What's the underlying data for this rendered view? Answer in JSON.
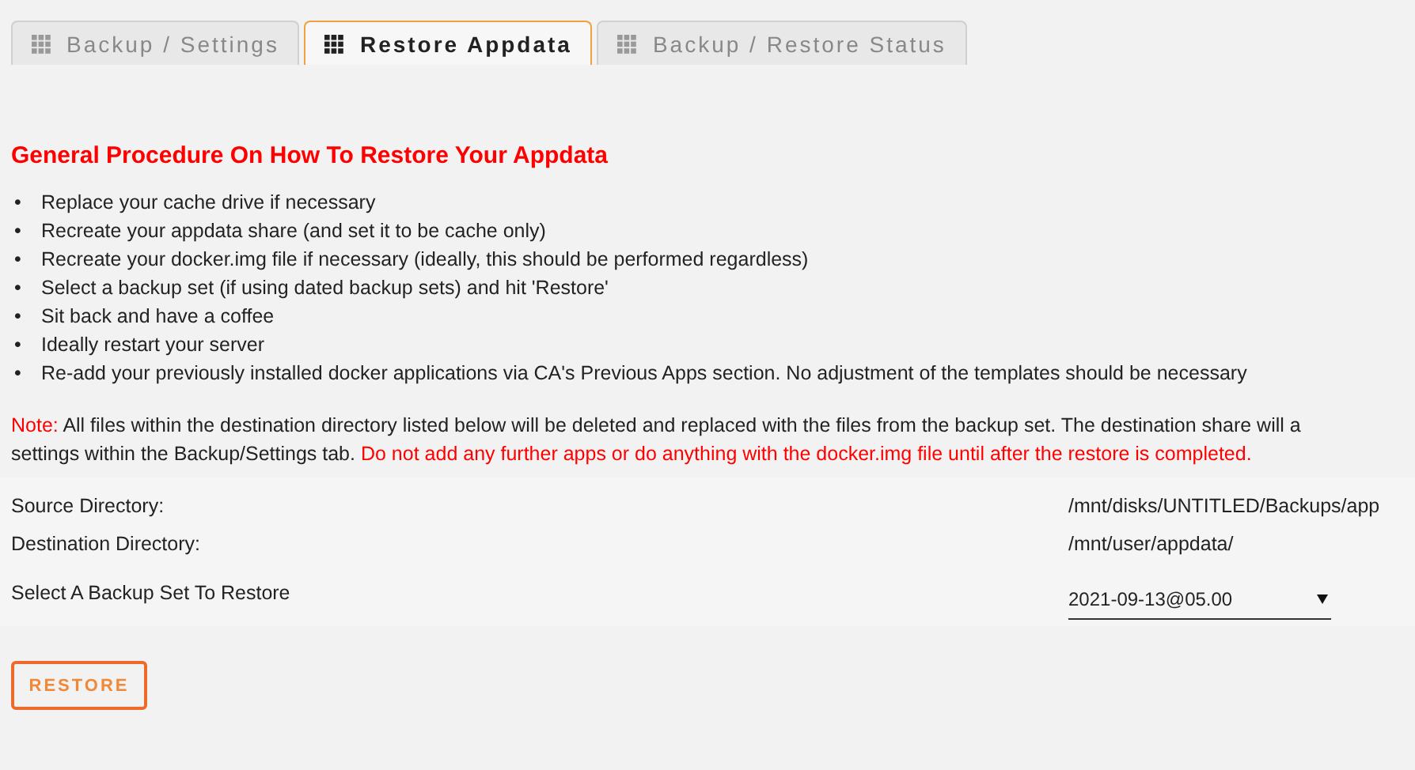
{
  "tabs": [
    {
      "label": "Backup / Settings",
      "selected": false
    },
    {
      "label": "Restore Appdata",
      "selected": true
    },
    {
      "label": "Backup / Restore Status",
      "selected": false
    }
  ],
  "heading": "General Procedure On How To Restore Your Appdata",
  "bullet": "•",
  "steps": [
    "Replace your cache drive if necessary",
    "Recreate your appdata share (and set it to be cache only)",
    "Recreate your docker.img file if necessary (ideally, this should be performed regardless)",
    "Select a backup set (if using dated backup sets) and hit 'Restore'",
    "Sit back and have a coffee",
    "Ideally restart your server",
    "Re-add your previously installed docker applications via CA's Previous Apps section. No adjustment of the templates should be necessary"
  ],
  "note": {
    "label": "Note:",
    "line_1": "All files within the destination directory listed below will be deleted and replaced with the files from the backup set. The destination share will a",
    "line_2": "settings within the Backup/Settings tab.",
    "warning": "Do not add any further apps or do anything with the docker.img file until after the restore is completed."
  },
  "settings": [
    {
      "kind": "text",
      "label": "Source Directory:",
      "value": "/mnt/disks/UNTITLED/Backups/app"
    },
    {
      "kind": "text",
      "label": "Destination Directory:",
      "value": "/mnt/user/appdata/"
    },
    {
      "kind": "select",
      "label": "Select A Backup Set To Restore",
      "value": "2021-09-13@05.00"
    }
  ],
  "restore_button": "RESTORE"
}
